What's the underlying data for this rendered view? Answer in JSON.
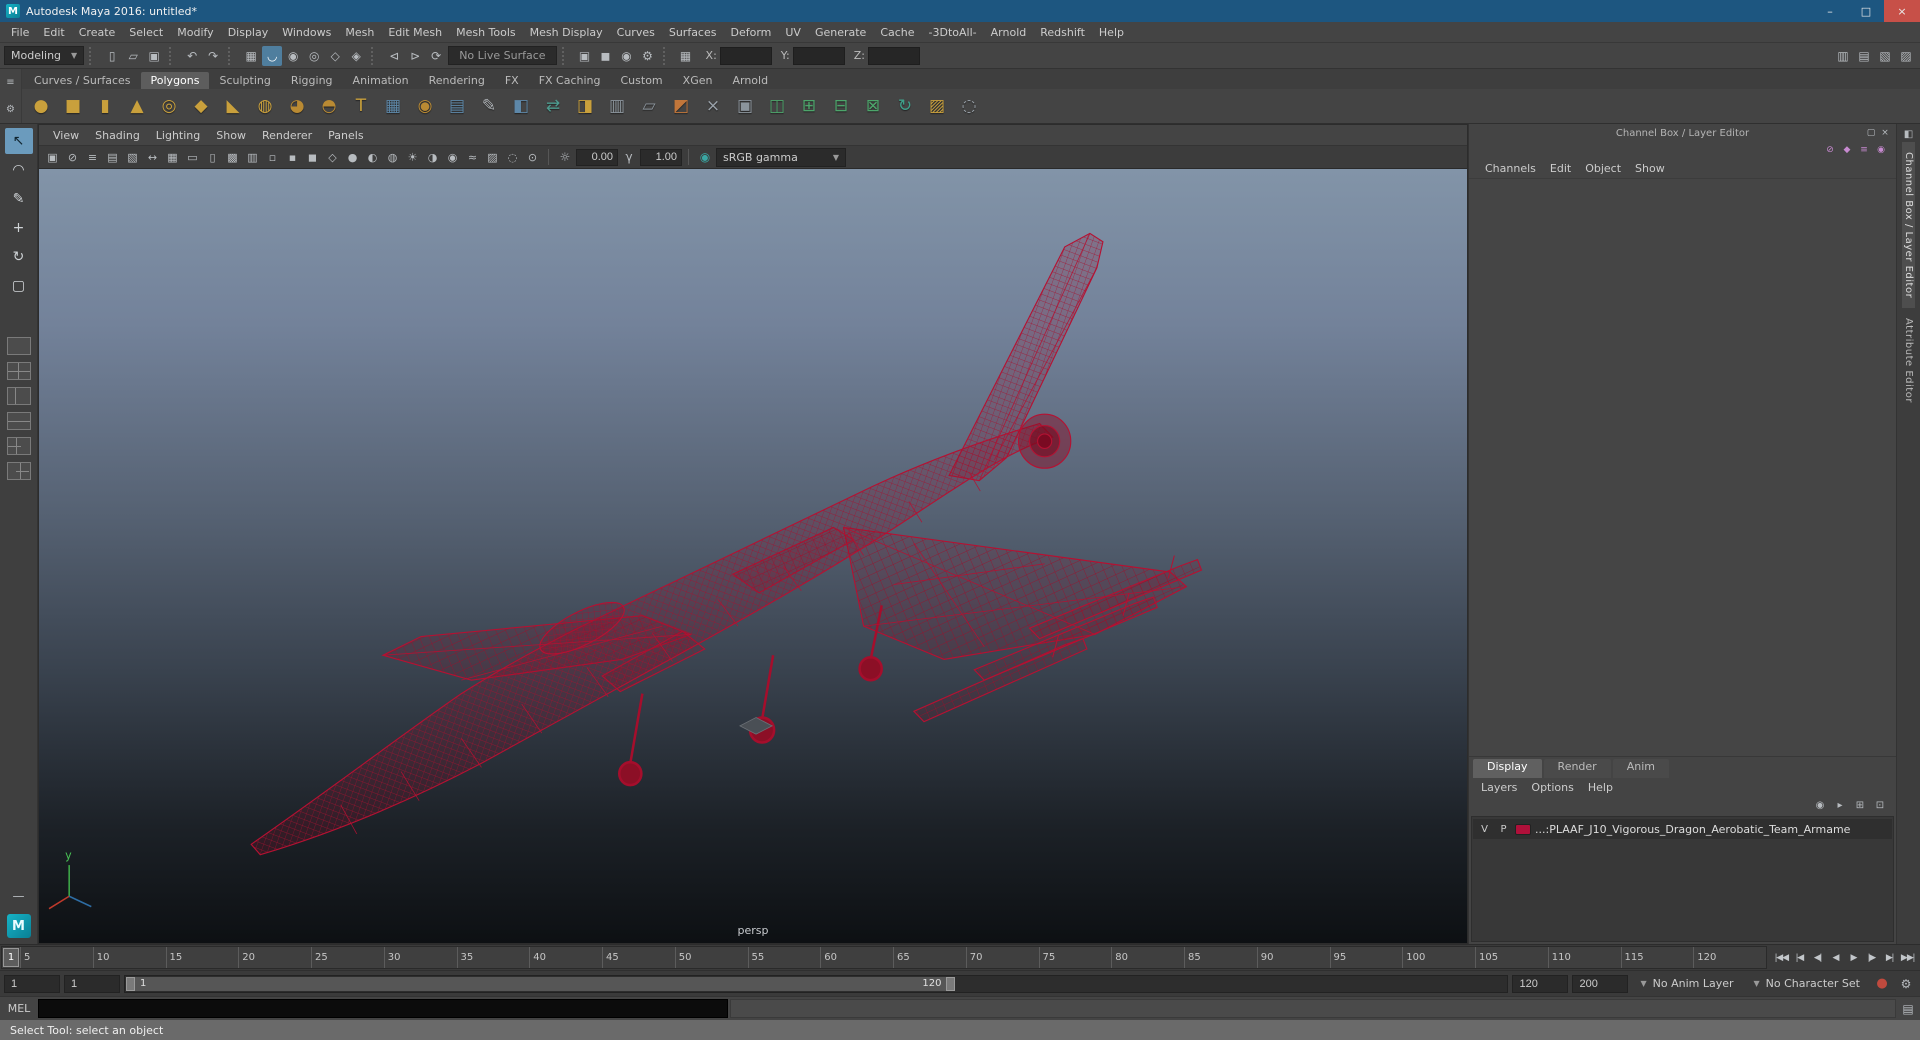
{
  "colors": {
    "titlebar": "#1d5680",
    "close_button": "#c75048",
    "ui_background": "#444444",
    "accent_highlight": "#6b9bbd",
    "wireframe_red": "#b51132",
    "viewport_top": "#8294a8",
    "viewport_bottom": "#0d1013",
    "layer_swatch": "#b0103a"
  },
  "window": {
    "app_icon": "M",
    "title": "Autodesk Maya 2016: untitled*",
    "controls": [
      {
        "name": "minimize-button",
        "glyph": "–"
      },
      {
        "name": "maximize-button",
        "glyph": "□"
      },
      {
        "name": "close-button",
        "glyph": "×"
      }
    ]
  },
  "menu_bar": [
    "File",
    "Edit",
    "Create",
    "Select",
    "Modify",
    "Display",
    "Windows",
    "Mesh",
    "Edit Mesh",
    "Mesh Tools",
    "Mesh Display",
    "Curves",
    "Surfaces",
    "Deform",
    "UV",
    "Generate",
    "Cache",
    "-3DtoAll-",
    "Arnold",
    "Redshift",
    "Help"
  ],
  "status_line": {
    "menuset": "Modeling",
    "file_icons": [
      {
        "name": "new-scene-icon",
        "glyph": "▯"
      },
      {
        "name": "open-scene-icon",
        "glyph": "▱"
      },
      {
        "name": "save-scene-icon",
        "glyph": "▣"
      }
    ],
    "edit_icons": [
      {
        "name": "undo-icon",
        "glyph": "↶"
      },
      {
        "name": "redo-icon",
        "glyph": "↷"
      }
    ],
    "snap_icons": [
      {
        "name": "snap-to-grid-icon",
        "glyph": "▦",
        "active": false
      },
      {
        "name": "snap-to-curve-icon",
        "glyph": "◡",
        "active": true
      },
      {
        "name": "snap-to-point-icon",
        "glyph": "◉",
        "active": false
      },
      {
        "name": "snap-to-projected-center-icon",
        "glyph": "◎",
        "active": false
      },
      {
        "name": "snap-to-view-plane-icon",
        "glyph": "◇",
        "active": false
      },
      {
        "name": "make-object-live-icon",
        "glyph": "◈",
        "active": false
      }
    ],
    "history_icons": [
      {
        "name": "input-connections-icon",
        "glyph": "⊲"
      },
      {
        "name": "output-connections-icon",
        "glyph": "⊳"
      },
      {
        "name": "construction-history-icon",
        "glyph": "⟳"
      }
    ],
    "live_surface": "No Live Surface",
    "render_icons": [
      {
        "name": "render-view-icon",
        "glyph": "▣"
      },
      {
        "name": "render-current-frame-icon",
        "glyph": "◼"
      },
      {
        "name": "ipr-render-icon",
        "glyph": "◉"
      },
      {
        "name": "render-settings-icon",
        "glyph": "⚙"
      }
    ],
    "selection_grid_glyph": "▦",
    "coords": [
      {
        "label": "X:",
        "value": ""
      },
      {
        "label": "Y:",
        "value": ""
      },
      {
        "label": "Z:",
        "value": ""
      }
    ],
    "right_icons": [
      {
        "name": "toggle-modeling-toolkit-icon",
        "glyph": "▥"
      },
      {
        "name": "toggle-attribute-editor-icon",
        "glyph": "▤"
      },
      {
        "name": "toggle-tool-settings-icon",
        "glyph": "▧"
      },
      {
        "name": "toggle-channel-box-icon",
        "glyph": "▨"
      }
    ]
  },
  "shelf": {
    "menu_glyph": "≡",
    "gear_glyph": "⚙",
    "tabs": [
      {
        "label": "Curves / Surfaces",
        "active": false
      },
      {
        "label": "Polygons",
        "active": true
      },
      {
        "label": "Sculpting",
        "active": false
      },
      {
        "label": "Rigging",
        "active": false
      },
      {
        "label": "Animation",
        "active": false
      },
      {
        "label": "Rendering",
        "active": false
      },
      {
        "label": "FX",
        "active": false
      },
      {
        "label": "FX Caching",
        "active": false
      },
      {
        "label": "Custom",
        "active": false
      },
      {
        "label": "XGen",
        "active": false
      },
      {
        "label": "Arnold",
        "active": false
      }
    ],
    "icons": [
      {
        "name": "poly-sphere-icon",
        "glyph": "●",
        "color": "#c9a03c"
      },
      {
        "name": "poly-cube-icon",
        "glyph": "■",
        "color": "#c9a03c"
      },
      {
        "name": "poly-cylinder-icon",
        "glyph": "▮",
        "color": "#c9a03c"
      },
      {
        "name": "poly-cone-icon",
        "glyph": "▲",
        "color": "#c9a03c"
      },
      {
        "name": "poly-torus-icon",
        "glyph": "◎",
        "color": "#c9a03c"
      },
      {
        "name": "poly-plane-icon",
        "glyph": "◆",
        "color": "#c9a03c"
      },
      {
        "name": "poly-pyramid-icon",
        "glyph": "◣",
        "color": "#c9a03c"
      },
      {
        "name": "poly-pipe-icon",
        "glyph": "◍",
        "color": "#c9a03c"
      },
      {
        "name": "poly-helix-icon",
        "glyph": "◕",
        "color": "#b98a33"
      },
      {
        "name": "platonic-solid-icon",
        "glyph": "◓",
        "color": "#b98a33"
      },
      {
        "name": "poly-text-icon",
        "glyph": "T",
        "color": "#c9a03c"
      },
      {
        "name": "subdiv-proxy-icon",
        "glyph": "▦",
        "color": "#5d87a8"
      },
      {
        "name": "smooth-mesh-icon",
        "glyph": "◉",
        "color": "#b98a33"
      },
      {
        "name": "reduce-mesh-icon",
        "glyph": "▤",
        "color": "#5d87a8"
      },
      {
        "name": "multi-cut-icon",
        "glyph": "✎",
        "color": "#b0b4b8"
      },
      {
        "name": "extrude-icon",
        "glyph": "◧",
        "color": "#5d87a8"
      },
      {
        "name": "merge-vertices-icon",
        "glyph": "⇄",
        "color": "#4d9a8e"
      },
      {
        "name": "bevel-icon",
        "glyph": "◨",
        "color": "#c9a03c"
      },
      {
        "name": "bridge-icon",
        "glyph": "▥",
        "color": "#8b949c"
      },
      {
        "name": "append-polygon-icon",
        "glyph": "▱",
        "color": "#8b949c"
      },
      {
        "name": "quad-draw-icon",
        "glyph": "◩",
        "color": "#c2763a"
      },
      {
        "name": "target-weld-icon",
        "glyph": "×",
        "color": "#9aa2aa"
      },
      {
        "name": "insert-edge-loop-icon",
        "glyph": "▣",
        "color": "#8b949c"
      },
      {
        "name": "make-live-shelf-icon",
        "glyph": "◫",
        "color": "#4da56b"
      },
      {
        "name": "symmetry-icon",
        "glyph": "⊞",
        "color": "#4da56b"
      },
      {
        "name": "mirror-icon",
        "glyph": "⊟",
        "color": "#4da56b"
      },
      {
        "name": "duplicate-icon",
        "glyph": "⊠",
        "color": "#4da56b"
      },
      {
        "name": "circularize-icon",
        "glyph": "↻",
        "color": "#3fa08a"
      },
      {
        "name": "grid-shelf-icon",
        "glyph": "▨",
        "color": "#c9a03c"
      },
      {
        "name": "cleanup-icon",
        "glyph": "◌",
        "color": "#9aa2aa"
      }
    ]
  },
  "toolbox": {
    "tools": [
      {
        "name": "select-tool",
        "glyph": "↖",
        "active": true
      },
      {
        "name": "lasso-tool",
        "glyph": "◠",
        "active": false
      },
      {
        "name": "paint-select-tool",
        "glyph": "✎",
        "active": false
      },
      {
        "name": "move-tool",
        "glyph": "+",
        "active": false
      },
      {
        "name": "rotate-tool",
        "glyph": "↻",
        "active": false
      },
      {
        "name": "scale-tool",
        "glyph": "▢",
        "active": false
      }
    ],
    "layouts": [
      {
        "name": "layout-single-pane",
        "split": "none"
      },
      {
        "name": "layout-four-pane",
        "split": "quad"
      },
      {
        "name": "layout-persp-outliner",
        "split": "vsplit"
      },
      {
        "name": "layout-persp-graph",
        "split": "hsplit"
      },
      {
        "name": "layout-persp-multi",
        "split": "left-stack"
      },
      {
        "name": "layout-custom",
        "split": "right-stack"
      }
    ],
    "collapse_glyph": "—",
    "logo_label": "M"
  },
  "panel": {
    "menu": [
      "View",
      "Shading",
      "Lighting",
      "Show",
      "Renderer",
      "Panels"
    ],
    "toolbar": {
      "icons": [
        {
          "name": "select-camera-icon",
          "glyph": "▣"
        },
        {
          "name": "lock-camera-icon",
          "glyph": "⊘"
        },
        {
          "name": "camera-attributes-icon",
          "glyph": "≡"
        },
        {
          "name": "bookmarks-icon",
          "glyph": "▤"
        },
        {
          "name": "image-plane-icon",
          "glyph": "▧"
        },
        {
          "name": "two-d-pan-zoom-icon",
          "glyph": "↔"
        },
        {
          "name": "grid-icon",
          "glyph": "▦"
        },
        {
          "name": "film-gate-icon",
          "glyph": "▭"
        },
        {
          "name": "resolution-gate-icon",
          "glyph": "▯"
        },
        {
          "name": "gate-mask-icon",
          "glyph": "▩"
        },
        {
          "name": "field-chart-icon",
          "glyph": "▥"
        },
        {
          "name": "safe-action-icon",
          "glyph": "▫"
        },
        {
          "name": "safe-title-icon",
          "glyph": "▪"
        },
        {
          "name": "fill-icon",
          "glyph": "◼"
        },
        {
          "name": "wireframe-icon",
          "glyph": "◇"
        },
        {
          "name": "shaded-icon",
          "glyph": "●"
        },
        {
          "name": "textured-icon",
          "glyph": "◐"
        },
        {
          "name": "use-default-material-icon",
          "glyph": "◍"
        },
        {
          "name": "lights-icon",
          "glyph": "☀"
        },
        {
          "name": "shadows-icon",
          "glyph": "◑"
        },
        {
          "name": "occlusion-icon",
          "glyph": "◉"
        },
        {
          "name": "motion-blur-icon",
          "glyph": "≈"
        },
        {
          "name": "multisample-icon",
          "glyph": "▨"
        },
        {
          "name": "isolate-select-icon",
          "glyph": "◌"
        },
        {
          "name": "xray-icon",
          "glyph": "⊙"
        }
      ],
      "exposure_glyph": "☼",
      "exposure": "0.00",
      "gamma_glyph": "γ",
      "gamma": "1.00",
      "color_management_glyph": "◉",
      "colorspace": "sRGB gamma"
    },
    "camera_label": "persp"
  },
  "channel_box": {
    "title": "Channel Box / Layer Editor",
    "title_icons": [
      {
        "name": "panel-popout-icon",
        "glyph": "▢"
      },
      {
        "name": "panel-close-icon",
        "glyph": "×"
      }
    ],
    "manip_icons": [
      {
        "name": "speed-slow-icon",
        "glyph": "⊘"
      },
      {
        "name": "speed-medium-icon",
        "glyph": "◆"
      },
      {
        "name": "speed-fast-icon",
        "glyph": "≡"
      },
      {
        "name": "channel-manip-icon",
        "glyph": "◉"
      }
    ],
    "menu": [
      "Channels",
      "Edit",
      "Object",
      "Show"
    ],
    "layer_editor": {
      "tabs": [
        {
          "label": "Display",
          "active": true
        },
        {
          "label": "Render",
          "active": false
        },
        {
          "label": "Anim",
          "active": false
        }
      ],
      "menu": [
        "Layers",
        "Options",
        "Help"
      ],
      "icons": [
        {
          "name": "set-layer-visibility-icon",
          "glyph": "◉"
        },
        {
          "name": "set-layer-playback-icon",
          "glyph": "▸"
        },
        {
          "name": "create-empty-layer-icon",
          "glyph": "⊞"
        },
        {
          "name": "create-layer-from-selected-icon",
          "glyph": "⊡"
        }
      ],
      "layer": {
        "visibility": "V",
        "playback": "P",
        "color": "#b0103a",
        "name": "...:PLAAF_J10_Vigorous_Dragon_Aerobatic_Team_Armame"
      }
    }
  },
  "side_strip": {
    "dock_glyph": "◧",
    "tabs": [
      {
        "label": "Channel Box / Layer Editor",
        "active": true
      },
      {
        "label": "Attribute Editor",
        "active": false
      }
    ]
  },
  "timeline": {
    "current_frame": "1",
    "ticks": [
      "5",
      "10",
      "15",
      "20",
      "25",
      "30",
      "35",
      "40",
      "45",
      "50",
      "55",
      "60",
      "65",
      "70",
      "75",
      "80",
      "85",
      "90",
      "95",
      "100",
      "105",
      "110",
      "115",
      "120"
    ],
    "playback": [
      {
        "name": "go-to-start-button",
        "glyph": "|◀◀"
      },
      {
        "name": "step-back-key-button",
        "glyph": "|◀"
      },
      {
        "name": "step-back-frame-button",
        "glyph": "◀|"
      },
      {
        "name": "play-backwards-button",
        "glyph": "◀"
      },
      {
        "name": "play-forwards-button",
        "glyph": "▶"
      },
      {
        "name": "step-forward-frame-button",
        "glyph": "|▶"
      },
      {
        "name": "step-forward-key-button",
        "glyph": "▶|"
      },
      {
        "name": "go-to-end-button",
        "glyph": "▶▶|"
      }
    ]
  },
  "range_slider": {
    "animation_start": "1",
    "playback_start": "1",
    "playback_end": "120",
    "animation_end": "200",
    "anim_layer": "No Anim Layer",
    "character_set": "No Character Set",
    "autokey_glyph": "●",
    "preferences_glyph": "⚙"
  },
  "command_line": {
    "label": "MEL",
    "input_value": "",
    "script_editor_glyph": "▤"
  },
  "help_line": {
    "text": "Select Tool: select an object"
  }
}
